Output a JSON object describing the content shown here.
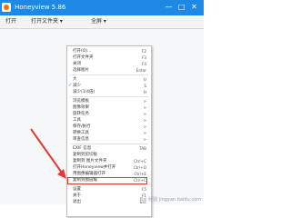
{
  "window": {
    "title": "Honeyview 5.86",
    "controls": [
      "—",
      "□",
      "✕"
    ]
  },
  "toolbar": {
    "buttons": [
      "打开",
      "打开文件夹 ▾",
      "全屏 ▾"
    ]
  },
  "menu": {
    "items": [
      {
        "label": "打开(O)...",
        "shortcut": "F2"
      },
      {
        "label": "打开文件夹",
        "shortcut": "F3"
      },
      {
        "label": "关闭",
        "shortcut": "F4"
      },
      {
        "label": "选择图片",
        "shortcut": "Enter"
      },
      {
        "sep": true
      },
      {
        "label": "大",
        "shortcut": "U"
      },
      {
        "label": "减少",
        "shortcut": "S",
        "checked": true
      },
      {
        "label": "减少(1/4倍)",
        "shortcut": "H"
      },
      {
        "sep": true
      },
      {
        "label": "浏览模板",
        "shortcut": ">"
      },
      {
        "label": "图像效果",
        "shortcut": ">"
      },
      {
        "label": "旋转任务",
        "shortcut": ">"
      },
      {
        "label": "工具",
        "shortcut": ">"
      },
      {
        "label": "保存/执行",
        "shortcut": ">"
      },
      {
        "label": "转换工具",
        "shortcut": ">"
      },
      {
        "label": "审查信息",
        "shortcut": ">"
      },
      {
        "sep": true
      },
      {
        "label": "EXIF 信息",
        "shortcut": "TAB"
      },
      {
        "label": "复制到剪切板",
        "shortcut": ""
      },
      {
        "label": "复制到 图片文件夹",
        "shortcut": "Ctrl+C"
      },
      {
        "label": "打开Honeyview并打开",
        "shortcut": "Ctrl+O"
      },
      {
        "label": "用图像编辑器打开",
        "shortcut": "Ctrl+E"
      },
      {
        "label": "复制到图层缓",
        "shortcut": "Ctrl+C"
      },
      {
        "sep": true
      },
      {
        "label": "设置",
        "shortcut": "F5",
        "highlighted": true
      },
      {
        "label": "关于",
        "shortcut": "F1"
      },
      {
        "label": "退出",
        "shortcut": "Esc"
      }
    ]
  },
  "watermark": "Bai 经验 jingyan.baidu.com",
  "colors": {
    "titlebar": "#1e88e5",
    "highlight": "#e53935"
  }
}
